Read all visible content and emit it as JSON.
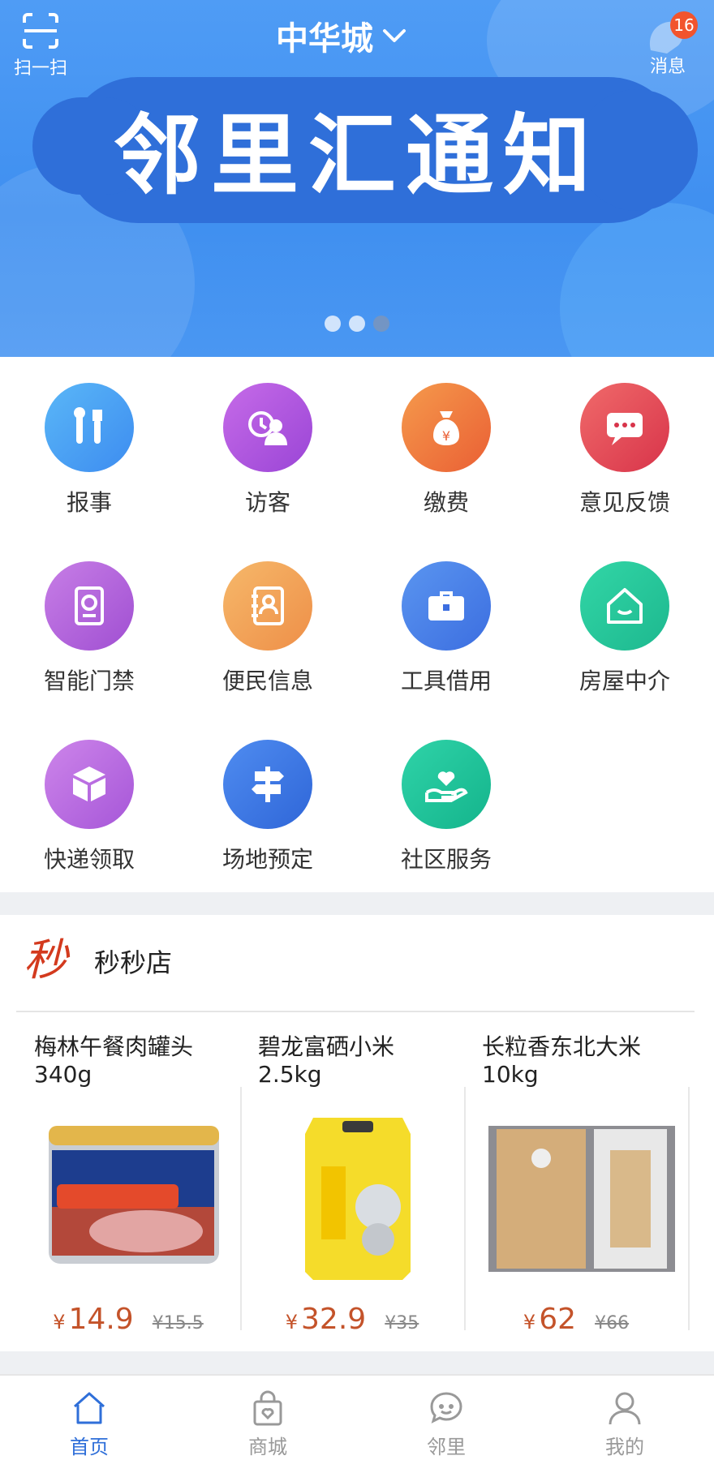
{
  "header": {
    "scan_label": "扫一扫",
    "city": "中华城",
    "message_label": "消息",
    "message_count": "16"
  },
  "banner": {
    "title": "邻里汇通知",
    "slide_count": 3,
    "active_slide": 3
  },
  "services": [
    {
      "label": "报事",
      "icon": "tools-icon",
      "color": "#4fb0f3"
    },
    {
      "label": "访客",
      "icon": "visitor-icon",
      "color": "#b35ae0"
    },
    {
      "label": "缴费",
      "icon": "money-bag-icon",
      "color": "#f07a3c"
    },
    {
      "label": "意见反馈",
      "icon": "chat-bubble-icon",
      "color": "#e44b58"
    },
    {
      "label": "智能门禁",
      "icon": "access-control-icon",
      "color": "#b66ad6"
    },
    {
      "label": "便民信息",
      "icon": "contact-book-icon",
      "color": "#f2a55c"
    },
    {
      "label": "工具借用",
      "icon": "toolbox-icon",
      "color": "#4d86e8"
    },
    {
      "label": "房屋中介",
      "icon": "house-icon",
      "color": "#2ccf9e"
    },
    {
      "label": "快递领取",
      "icon": "package-icon",
      "color": "#c071e0"
    },
    {
      "label": "场地预定",
      "icon": "signpost-icon",
      "color": "#3b7ae4"
    },
    {
      "label": "社区服务",
      "icon": "heart-hand-icon",
      "color": "#22c79c"
    }
  ],
  "shop": {
    "logo_text": "秒",
    "title": "秒秒店",
    "currency": "¥",
    "products": [
      {
        "name_line1": "梅林午餐肉罐头",
        "name_line2": "340g",
        "price": "14.9",
        "old_price": "¥15.5"
      },
      {
        "name_line1": "碧龙富硒小米",
        "name_line2": "2.5kg",
        "price": "32.9",
        "old_price": "¥35"
      },
      {
        "name_line1": "长粒香东北大米",
        "name_line2": "10kg",
        "price": "62",
        "old_price": "¥66"
      }
    ]
  },
  "tabs": [
    {
      "label": "首页",
      "icon": "home-icon",
      "active": true
    },
    {
      "label": "商城",
      "icon": "shopping-bag-icon",
      "active": false
    },
    {
      "label": "邻里",
      "icon": "chat-icon",
      "active": false
    },
    {
      "label": "我的",
      "icon": "profile-icon",
      "active": false
    }
  ],
  "colors": {
    "brand": "#2f6fd9",
    "price": "#c4532a",
    "badge": "#f2542d"
  }
}
